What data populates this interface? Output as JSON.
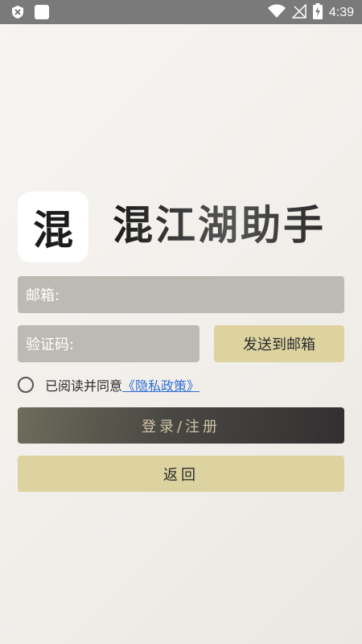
{
  "status_bar": {
    "time": "4:39",
    "icons": [
      "shield-icon",
      "app-square-icon",
      "wifi-icon",
      "signal-icon",
      "battery-charging-icon"
    ]
  },
  "app": {
    "logo_char": "混",
    "title": "混江湖助手"
  },
  "form": {
    "email_label": "邮箱:",
    "email_value": "",
    "code_label": "验证码:",
    "code_value": "",
    "send_label": "发送到邮箱",
    "agree_text": "已阅读并同意",
    "privacy_link": "《隐私政策》",
    "agree_checked": false
  },
  "actions": {
    "login_label": "登录/注册",
    "back_label": "返回"
  },
  "colors": {
    "status_bar": "#7a7a7a",
    "field_bg": "#bdbab3",
    "accent_gold": "#ddd3a0",
    "link": "#2f6fd6",
    "login_text": "#cfc4a6"
  }
}
